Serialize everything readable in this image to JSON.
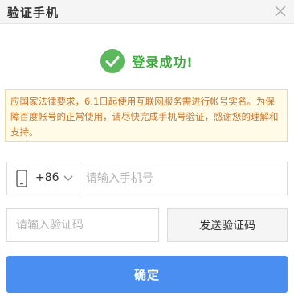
{
  "dialog": {
    "title": "验证手机",
    "close_icon": "close-icon"
  },
  "status": {
    "icon": "check-circle-icon",
    "text": "登录成功!",
    "color": "#3caa3c"
  },
  "notice": {
    "text": "应国家法律要求，6.1日起使用互联网服务需进行帐号实名。为保障百度帐号的正常使用，请尽快完成手机号验证，感谢您的理解和支持。"
  },
  "phone": {
    "icon": "mobile-phone-icon",
    "country_code": "+86",
    "dropdown_icon": "chevron-down-icon",
    "placeholder": "请输入手机号",
    "value": ""
  },
  "verification": {
    "placeholder": "请输入验证码",
    "value": "",
    "send_label": "发送验证码"
  },
  "confirm": {
    "label": "确定",
    "color": "#4a8ef2"
  }
}
